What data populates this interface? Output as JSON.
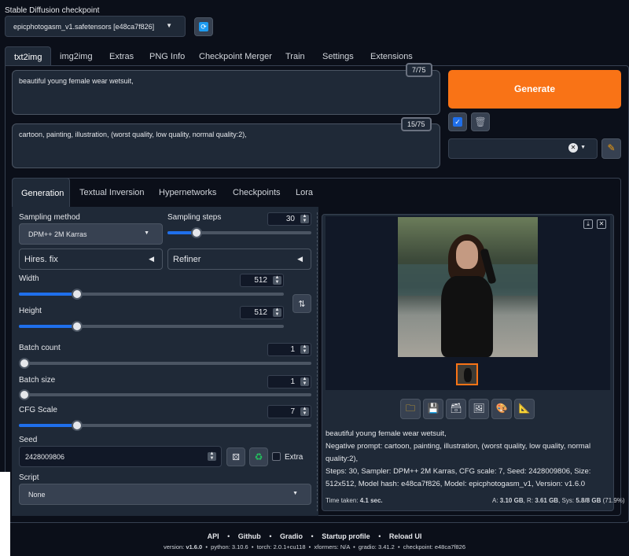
{
  "checkpoint": {
    "label": "Stable Diffusion checkpoint",
    "value": "epicphotogasm_v1.safetensors [e48ca7f826]"
  },
  "main_tabs": [
    "txt2img",
    "img2img",
    "Extras",
    "PNG Info",
    "Checkpoint Merger",
    "Train",
    "Settings",
    "Extensions"
  ],
  "prompt": {
    "text": "beautiful young female wear wetsuit,",
    "token_count": "7/75"
  },
  "negative_prompt": {
    "text": "cartoon, painting, illustration, (worst quality, low quality, normal quality:2),",
    "token_count": "15/75"
  },
  "generate_label": "Generate",
  "sub_tabs": [
    "Generation",
    "Textual Inversion",
    "Hypernetworks",
    "Checkpoints",
    "Lora"
  ],
  "sampling_method": {
    "label": "Sampling method",
    "value": "DPM++ 2M Karras"
  },
  "sampling_steps": {
    "label": "Sampling steps",
    "value": "30",
    "level": 0.2
  },
  "hires_fix": "Hires. fix",
  "refiner": "Refiner",
  "width": {
    "label": "Width",
    "value": "512",
    "level": 0.22
  },
  "height": {
    "label": "Height",
    "value": "512",
    "level": 0.22
  },
  "batch_count": {
    "label": "Batch count",
    "value": "1",
    "level": 0.0
  },
  "batch_size": {
    "label": "Batch size",
    "value": "1",
    "level": 0.0
  },
  "cfg_scale": {
    "label": "CFG Scale",
    "value": "7",
    "level": 0.2
  },
  "seed": {
    "label": "Seed",
    "value": "2428009806",
    "extra_label": "Extra"
  },
  "script": {
    "label": "Script",
    "value": "None"
  },
  "generation_info": {
    "prompt": "beautiful young female wear wetsuit,",
    "negative": "Negative prompt: cartoon, painting, illustration, (worst quality, low quality, normal quality:2),",
    "params": "Steps: 30, Sampler: DPM++ 2M Karras, CFG scale: 7, Seed: 2428009806, Size: 512x512, Model hash: e48ca7f826, Model: epicphotogasm_v1, Version: v1.6.0"
  },
  "time_taken": {
    "label": "Time taken:",
    "value": "4.1 sec.",
    "a_label": "A:",
    "a_value": "3.10 GB",
    "r_label": "R:",
    "r_value": "3.61 GB",
    "sys_label": "Sys:",
    "sys_value": "5.8/8 GB",
    "sys_pct": "(71.9%)"
  },
  "footer_links": [
    "API",
    "Github",
    "Gradio",
    "Startup profile",
    "Reload UI"
  ],
  "footer_versions": {
    "version_label": "version:",
    "version": "v1.6.0",
    "python_label": "python:",
    "python": "3.10.6",
    "torch_label": "torch:",
    "torch": "2.0.1+cu118",
    "xformers_label": "xformers:",
    "xformers": "N/A",
    "gradio_label": "gradio:",
    "gradio": "3.41.2",
    "checkpoint_label": "checkpoint:",
    "checkpoint": "e48ca7f826"
  },
  "colors": {
    "background": "#0b0f19",
    "generate": "#f97316",
    "accent_blue": "#1f6feb"
  },
  "icons": [
    "refresh-icon",
    "checkbox-icon",
    "trash-icon",
    "pencil-icon",
    "swap-icon",
    "dice-icon",
    "recycle-icon",
    "download-icon",
    "close-icon",
    "folder-icon",
    "save-icon",
    "zip-icon",
    "image-icon",
    "palette-icon",
    "ruler-icon"
  ]
}
